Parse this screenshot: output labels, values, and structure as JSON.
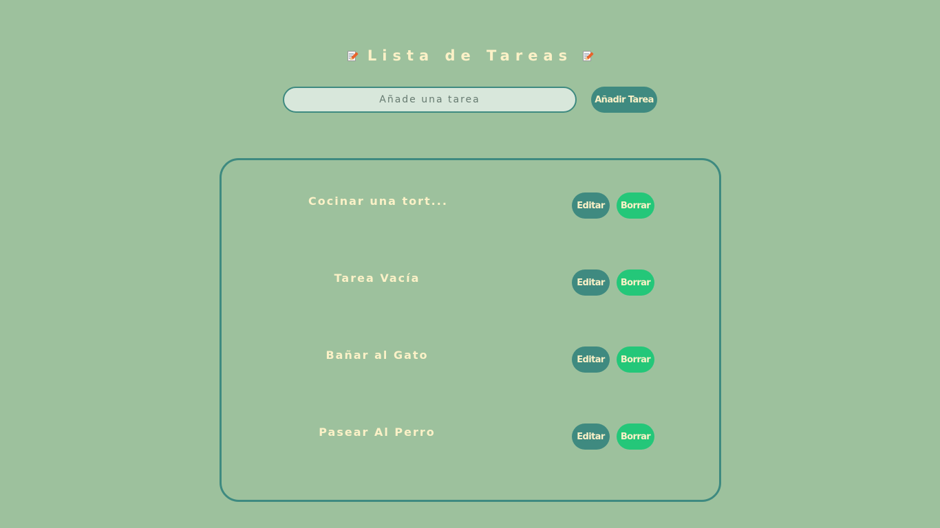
{
  "header": {
    "icon_left": "memo-icon",
    "title": "Lista de Tareas",
    "icon_right": "memo-icon"
  },
  "new_task": {
    "placeholder": "Añade una tarea",
    "value": "",
    "add_label": "Añadir Tarea"
  },
  "tasks": [
    {
      "text": "Cocinar una tort...",
      "edit_label": "Editar",
      "delete_label": "Borrar"
    },
    {
      "text": "Tarea Vacía",
      "edit_label": "Editar",
      "delete_label": "Borrar"
    },
    {
      "text": "Bañar al Gato",
      "edit_label": "Editar",
      "delete_label": "Borrar"
    },
    {
      "text": "Pasear Al Perro",
      "edit_label": "Editar",
      "delete_label": "Borrar"
    }
  ],
  "colors": {
    "background": "#9dc19d",
    "accent": "#3f8a80",
    "delete": "#24c779",
    "text": "#fbf1c7",
    "input_bg": "#d8e7db"
  }
}
